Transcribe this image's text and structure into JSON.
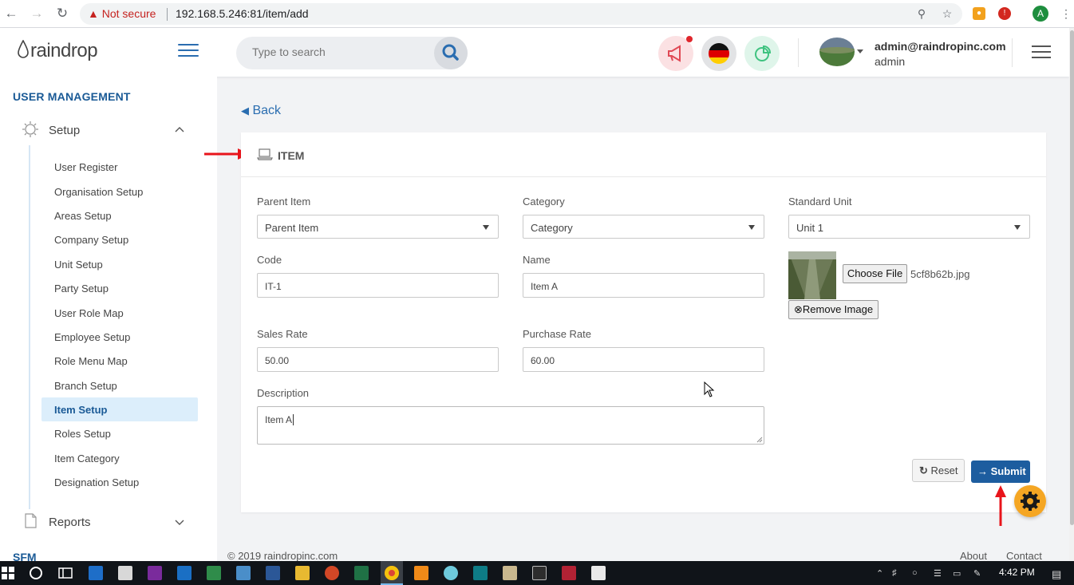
{
  "browser": {
    "security_label": "Not secure",
    "url": "192.168.5.246:81/item/add"
  },
  "header": {
    "logo": "raindrop",
    "search_placeholder": "Type to search",
    "user_email": "admin@raindropinc.com",
    "user_role": "admin"
  },
  "sidebar": {
    "section_title": "USER MANAGEMENT",
    "setup_label": "Setup",
    "items": [
      {
        "label": "User Register"
      },
      {
        "label": "Organisation Setup"
      },
      {
        "label": "Areas Setup"
      },
      {
        "label": "Company Setup"
      },
      {
        "label": "Unit Setup"
      },
      {
        "label": "Party Setup"
      },
      {
        "label": "User Role Map"
      },
      {
        "label": "Employee Setup"
      },
      {
        "label": "Role Menu Map"
      },
      {
        "label": "Branch Setup"
      },
      {
        "label": "Item Setup"
      },
      {
        "label": "Roles Setup"
      },
      {
        "label": "Item Category"
      },
      {
        "label": "Designation Setup"
      }
    ],
    "reports_label": "Reports",
    "next_section": "SFM"
  },
  "main": {
    "back_label": "Back",
    "card_title": "ITEM",
    "parent_item_label": "Parent Item",
    "parent_item_value": "Parent Item",
    "category_label": "Category",
    "category_value": "Category",
    "standard_unit_label": "Standard Unit",
    "standard_unit_value": "Unit 1",
    "code_label": "Code",
    "code_value": "IT-1",
    "name_label": "Name",
    "name_value": "Item A",
    "sales_rate_label": "Sales Rate",
    "sales_rate_value": "50.00",
    "purchase_rate_label": "Purchase Rate",
    "purchase_rate_value": "60.00",
    "description_label": "Description",
    "description_value": "Item A",
    "choose_file_label": "Choose File",
    "file_name": "5cf8b62b.jpg",
    "remove_image_label": "Remove Image",
    "reset_label": "Reset",
    "submit_label": "Submit"
  },
  "footer": {
    "copyright": "© 2019 raindropinc.com",
    "about": "About",
    "contact": "Contact"
  },
  "taskbar": {
    "time": "4:42 PM"
  },
  "colors": {
    "brand_blue": "#1d5d9f",
    "accent_link": "#2a6db0",
    "sidebar_active": "#dceefb",
    "gear_orange": "#f5a623",
    "annotation_red": "#e8141b"
  }
}
